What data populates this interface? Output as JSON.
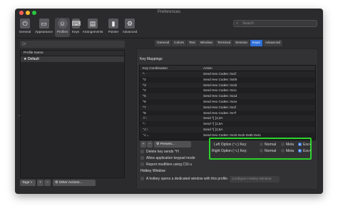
{
  "window": {
    "title": "Preferences"
  },
  "toolbar": {
    "items": [
      {
        "label": "General",
        "icon": "switch-icon"
      },
      {
        "label": "Appearance",
        "icon": "monitor-icon"
      },
      {
        "label": "Profiles",
        "icon": "profiles-icon"
      },
      {
        "label": "Keys",
        "icon": "keyboard-icon"
      },
      {
        "label": "Arrangements",
        "icon": "arrangements-icon"
      },
      {
        "label": "Pointer",
        "icon": "pointer-icon"
      },
      {
        "label": "Advanced",
        "icon": "gear-icon"
      }
    ],
    "search_placeholder": "Search"
  },
  "sidebar": {
    "filter_placeholder": "Q•",
    "header": "Profile Name",
    "profiles": [
      "★ Default"
    ],
    "tags_label": "Tags >",
    "add_label": "+",
    "remove_label": "−",
    "other_actions": "⚙ Other Actions..."
  },
  "tabs": [
    "General",
    "Colors",
    "Text",
    "Window",
    "Terminal",
    "Session",
    "Keys",
    "Advanced"
  ],
  "selected_tab": "Keys",
  "key_mappings": {
    "heading": "Key Mappings",
    "col_combo": "Key Combination",
    "col_action": "Action",
    "rows": [
      [
        "^-",
        "Send Hex Codes: 0x1f"
      ],
      [
        "^2",
        "Send Hex Codes: 0x00"
      ],
      [
        "^3",
        "Send Hex Codes: 0x1b"
      ],
      [
        "^4",
        "Send Hex Codes: 0x1c"
      ],
      [
        "^5",
        "Send Hex Codes: 0x1d"
      ],
      [
        "^6",
        "Send Hex Codes: 0x1e"
      ],
      [
        "^7",
        "Send Hex Codes: 0x1f"
      ],
      [
        "^8",
        "Send Hex Codes: 0x7f"
      ],
      [
        "⇧↑",
        "Send ^[ [1;2A"
      ],
      [
        "^↑",
        "Send ^[ [1;5A"
      ],
      [
        "⌥↑",
        "Send ^[ [1;6A"
      ],
      [
        "⌥←",
        "Send Hex Codes: 0x1b 0x1b 0x5b 0x41"
      ]
    ],
    "add": "+",
    "remove": "−",
    "presets": "⚙ Presets..."
  },
  "checkboxes": [
    "Delete key sends ^H",
    "Allow application keypad mode",
    "Report modifiers using CSI u"
  ],
  "option_keys": {
    "left_label": "Left Option (⌥) Key:",
    "right_label": "Right Option (⌥) Key:",
    "choices": [
      "Normal",
      "Meta",
      "Esc+"
    ],
    "left_selected": "Esc+",
    "right_selected": "Esc+"
  },
  "hotkey": {
    "heading": "Hotkey Window",
    "checkbox": "A hotkey opens a dedicated window with this profile.",
    "button": "Configure Hotkey Window"
  },
  "colors": {
    "accent": "#2f6fd8",
    "highlight": "#2bd22b"
  }
}
